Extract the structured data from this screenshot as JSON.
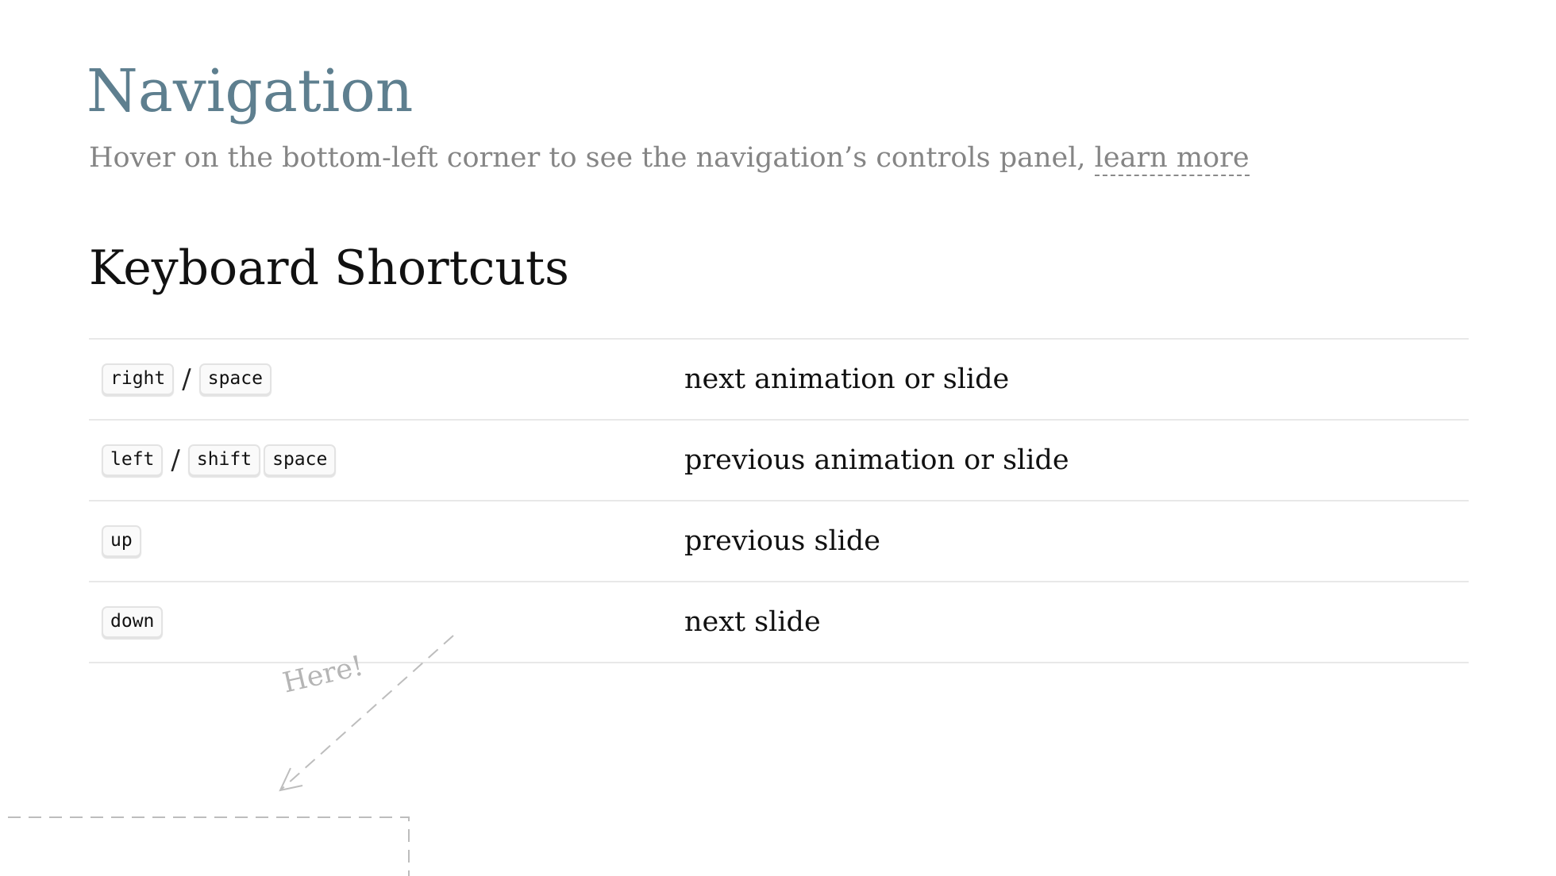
{
  "header": {
    "title": "Navigation",
    "subtitle_text": "Hover on the bottom-left corner to see the navigation’s controls panel, ",
    "learn_more_label": "learn more"
  },
  "shortcuts": {
    "heading": "Keyboard Shortcuts",
    "rows": [
      {
        "keys": [
          "right",
          "space"
        ],
        "description": "next animation or slide"
      },
      {
        "keys": [
          "left",
          "shift",
          "space"
        ],
        "description": "previous animation or slide"
      },
      {
        "keys": [
          "up"
        ],
        "description": "previous slide"
      },
      {
        "keys": [
          "down"
        ],
        "description": "next slide"
      }
    ],
    "separator": "/"
  },
  "annotation": {
    "hint_text": "Here!"
  },
  "colors": {
    "title": "#5e7f8f",
    "muted_text": "#858585",
    "rule": "#e8e8e8",
    "annotation": "#b5b5b5"
  }
}
